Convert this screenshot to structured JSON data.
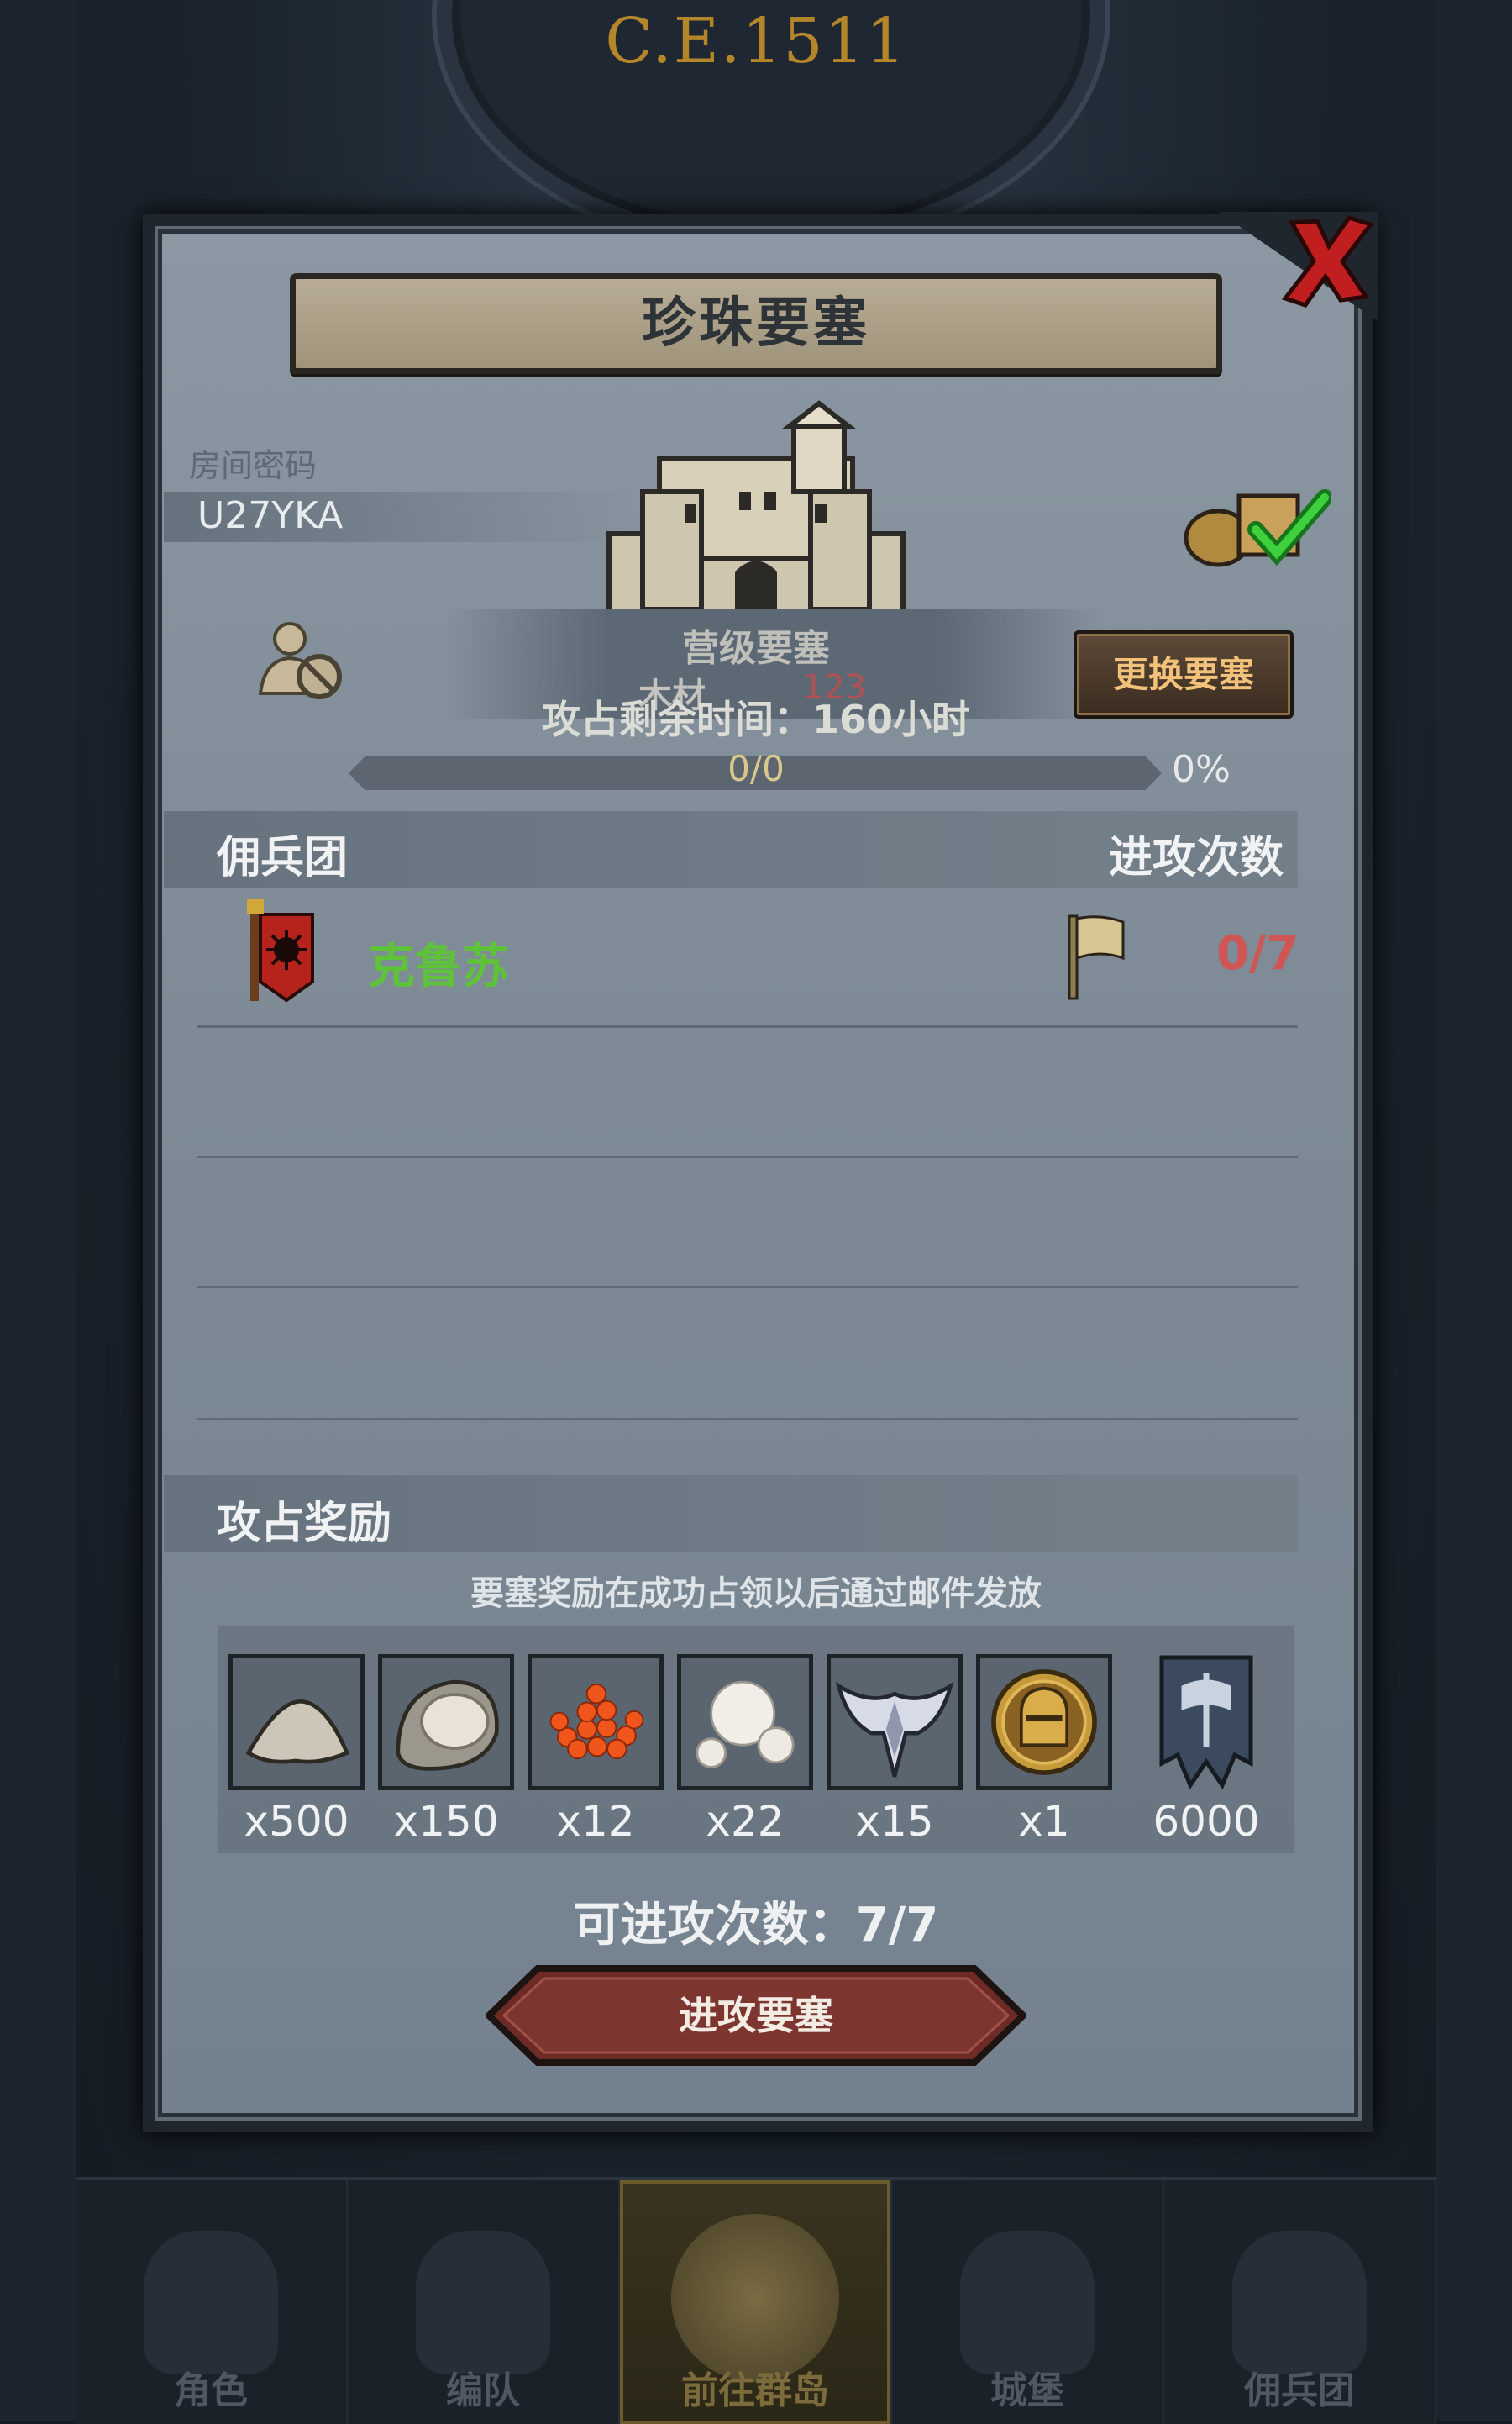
{
  "hud": {
    "year": "C.E.1511"
  },
  "dialog": {
    "title": "珍珠要塞",
    "room_label": "房间密码",
    "room_code": "U27YKA",
    "fortress_level": "营级要塞",
    "resource_label": "木材",
    "resource_value": "123",
    "capture_time": "攻占剩余时间：160小时",
    "change_button": "更换要塞",
    "progress_text": "0/0",
    "progress_percent": "0%",
    "progress_fraction": 0
  },
  "mercenary_section": {
    "title": "佣兵团",
    "attack_header": "进攻次数",
    "rows": [
      {
        "name": "克鲁苏",
        "attacks": "0/7"
      }
    ]
  },
  "reward_section": {
    "title": "攻占奖励",
    "note": "要塞奖励在成功占领以后通过邮件发放",
    "items": [
      {
        "icon": "sand-pile-icon",
        "count": "x500"
      },
      {
        "icon": "oyster-icon",
        "count": "x150"
      },
      {
        "icon": "fish-roe-icon",
        "count": "x12"
      },
      {
        "icon": "pearls-icon",
        "count": "x22"
      },
      {
        "icon": "winged-emblem-icon",
        "count": "x15"
      },
      {
        "icon": "knight-helmet-coin-icon",
        "count": "x1"
      },
      {
        "icon": "axe-banner-icon",
        "count": "6000"
      }
    ]
  },
  "available_attacks": "可进攻次数：7/7",
  "attack_button": "进攻要塞",
  "bottom_nav": [
    {
      "label": "角色"
    },
    {
      "label": "编队"
    },
    {
      "label": "前往群岛",
      "active": true
    },
    {
      "label": "城堡"
    },
    {
      "label": "佣兵团"
    }
  ],
  "colors": {
    "merc_name": "#5fc33a",
    "attack_count": "#d05555",
    "change_button_text": "#f3c27a",
    "year_gold": "#b5852a"
  }
}
